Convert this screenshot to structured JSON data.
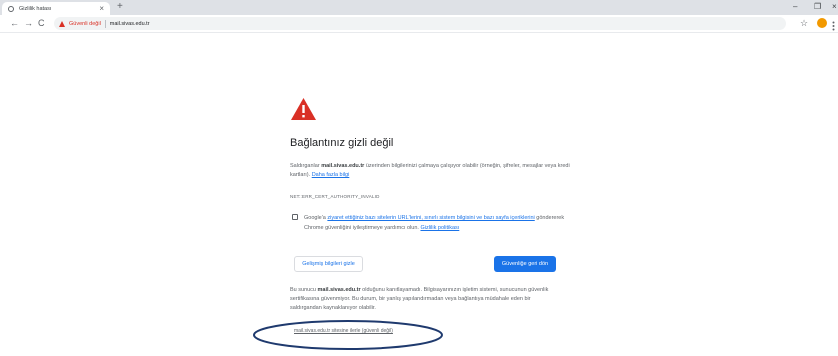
{
  "browser": {
    "tab": {
      "title": "Gizlilik hatası",
      "close_glyph": "×"
    },
    "new_tab_glyph": "+",
    "window_controls": {
      "minimize": "–",
      "maximize": "❐",
      "close": "×"
    },
    "nav": {
      "back": "←",
      "forward": "→",
      "reload": "C"
    },
    "omnibox": {
      "security_label": "Güvenli değil",
      "url": "mail.sivas.edu.tr"
    },
    "star_glyph": "☆"
  },
  "interstitial": {
    "heading": "Bağlantınız gizli değil",
    "para1": {
      "before": "Saldırganlar ",
      "domain": "mail.sivas.edu.tr",
      "after": " üzerinden bilgilerinizi çalmaya çalışıyor olabilir (örneğin, şifreler, mesajlar veya kredi kartları).",
      "learn_more": "Daha fazla bilgi"
    },
    "error_code": "NET::ERR_CERT_AUTHORITY_INVALID",
    "checkbox": {
      "before": "Google'a ",
      "link": "ziyaret ettiğiniz bazı sitelerin URL'lerini, sınırlı sistem bilgisini ve bazı sayfa içeriklerini",
      "middle": " göndererek Chrome güvenliğini iyileştirmeye yardımcı olun. ",
      "policy": "Gizlilik politikası"
    },
    "advanced_button": "Gelişmiş bilgileri gizle",
    "safety_button": "Güvenliğe geri dön",
    "para2": {
      "before": "Bu sunucu ",
      "domain": "mail.sivas.edu.tr",
      "after": " olduğunu kanıtlayamadı. Bilgisayarınızın işletim sistemi, sunucunun güvenlik sertifikasına güvenmiyor. Bu durum, bir yanlış yapılandırmadan veya bağlantıya müdahale eden bir saldırgandan kaynaklanıyor olabilir."
    },
    "proceed_link": "mail.sivas.edu.tr sitesine ilerle (güvenli değil)"
  },
  "icons": {
    "warning": "warning-icon",
    "lock_broken": "not-secure-icon",
    "star": "star-icon"
  },
  "colors": {
    "danger": "#d93025",
    "accent": "#1a73e8",
    "annotation": "#1f3a6e"
  }
}
